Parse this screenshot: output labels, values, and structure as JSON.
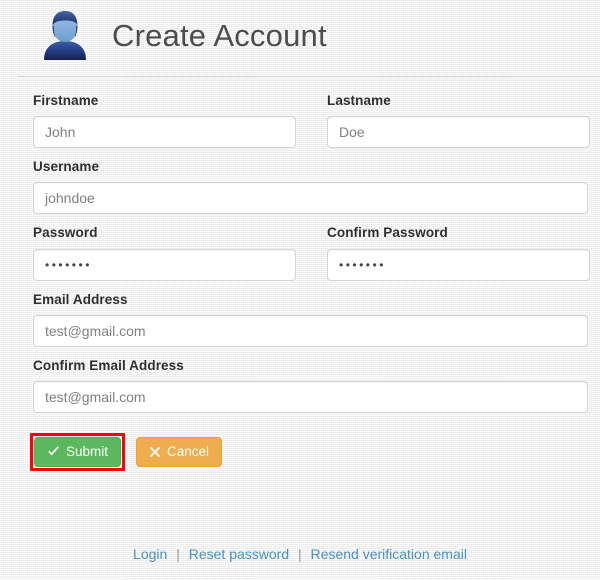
{
  "header": {
    "avatar_icon": "user-avatar-icon",
    "title": "Create Account"
  },
  "form": {
    "fields": [
      {
        "name": "firstname",
        "label": "Firstname",
        "placeholder": "John",
        "value": "",
        "type": "text",
        "width": "half"
      },
      {
        "name": "lastname",
        "label": "Lastname",
        "placeholder": "Doe",
        "value": "",
        "type": "text",
        "width": "half"
      },
      {
        "name": "username",
        "label": "Username",
        "placeholder": "johndoe",
        "value": "",
        "type": "text",
        "width": "full"
      },
      {
        "name": "password",
        "label": "Password",
        "placeholder": "•••••••",
        "value": "•••••••",
        "type": "password",
        "width": "half"
      },
      {
        "name": "confirm_password",
        "label": "Confirm Password",
        "placeholder": "•••••••",
        "value": "•••••••",
        "type": "password",
        "width": "half"
      },
      {
        "name": "email",
        "label": "Email Address",
        "placeholder": "test@gmail.com",
        "value": "",
        "type": "email",
        "width": "full"
      },
      {
        "name": "confirm_email",
        "label": "Confirm Email Address",
        "placeholder": "test@gmail.com",
        "value": "",
        "type": "email",
        "width": "full"
      }
    ],
    "labels": {
      "firstname": "Firstname",
      "lastname": "Lastname",
      "username": "Username",
      "password": "Password",
      "confirm_password": "Confirm Password",
      "email": "Email Address",
      "confirm_email": "Confirm Email Address"
    },
    "placeholders": {
      "firstname": "John",
      "lastname": "Doe",
      "username": "johndoe",
      "email": "test@gmail.com",
      "confirm_email": "test@gmail.com"
    },
    "values": {
      "password_masked": "•••••••",
      "confirm_password_masked": "•••••••"
    }
  },
  "buttons": {
    "submit": {
      "label": "Submit",
      "icon": "check-icon",
      "color": "#5cb85c",
      "highlighted": true,
      "highlight_color": "#ff0000"
    },
    "cancel": {
      "label": "Cancel",
      "icon": "times-icon",
      "color": "#f0ad4e"
    }
  },
  "footer": {
    "links": [
      {
        "name": "login",
        "label": "Login"
      },
      {
        "name": "reset-password",
        "label": "Reset password"
      },
      {
        "name": "resend-verification-email",
        "label": "Resend verification email"
      }
    ],
    "separator": "|",
    "link_color": "#4a90c2"
  },
  "theme": {
    "background": "#efefef",
    "label_color": "#2f2f2f",
    "title_color": "#4d4d4d",
    "input_border": "#d4d4d4",
    "placeholder_color": "#808080",
    "divider_color": "#d2d2d2"
  }
}
